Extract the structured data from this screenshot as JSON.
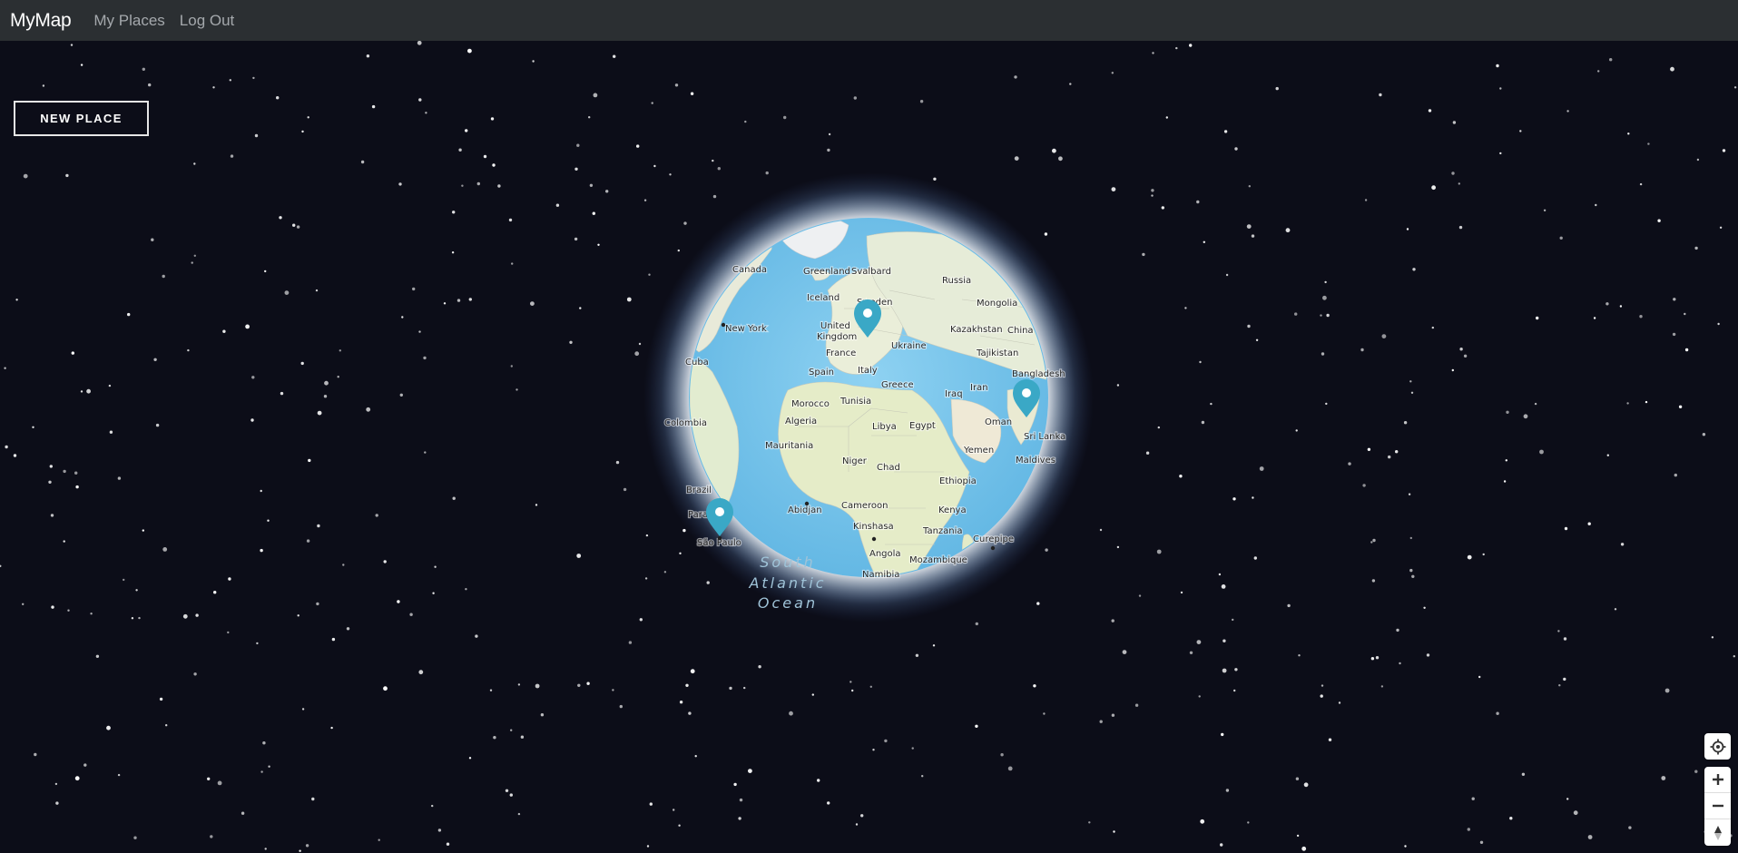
{
  "navbar": {
    "brand": "MyMap",
    "links": [
      "My Places",
      "Log Out"
    ]
  },
  "map": {
    "new_place_label": "NEW PLACE",
    "ocean_label": [
      "South",
      "Atlantic",
      "Ocean"
    ],
    "place_labels": [
      "Canada",
      "Greenland",
      "Svalbard",
      "Russia",
      "Iceland",
      "Sweden",
      "Mongolia",
      "New York",
      "United",
      "Kingdom",
      "Kazakhstan",
      "China",
      "Ukraine",
      "France",
      "Tajikistan",
      "Cuba",
      "Spain",
      "Italy",
      "Bangladesh",
      "Greece",
      "Iran",
      "Iraq",
      "Morocco",
      "Tunisia",
      "Colombia",
      "Algeria",
      "Libya",
      "Egypt",
      "Oman",
      "Sri Lanka",
      "Mauritania",
      "Yemen",
      "Niger",
      "Chad",
      "Maldives",
      "Ethiopia",
      "Brazil",
      "Abidjan",
      "Cameroon",
      "Kenya",
      "Para",
      "Kinshasa",
      "Tanzania",
      "Curepipe",
      "São Paulo",
      "Angola",
      "Mozambique",
      "Namibia"
    ],
    "markers": [
      "pin-icon",
      "pin-icon",
      "pin-icon"
    ],
    "colors": {
      "ocean": "#7ec8ec",
      "land": "#e9ebdd",
      "marker": "#3aa8c6",
      "space": "#0c0d18"
    }
  },
  "controls": [
    "locate-icon",
    "zoom-in-icon",
    "zoom-out-icon",
    "compass-icon"
  ]
}
